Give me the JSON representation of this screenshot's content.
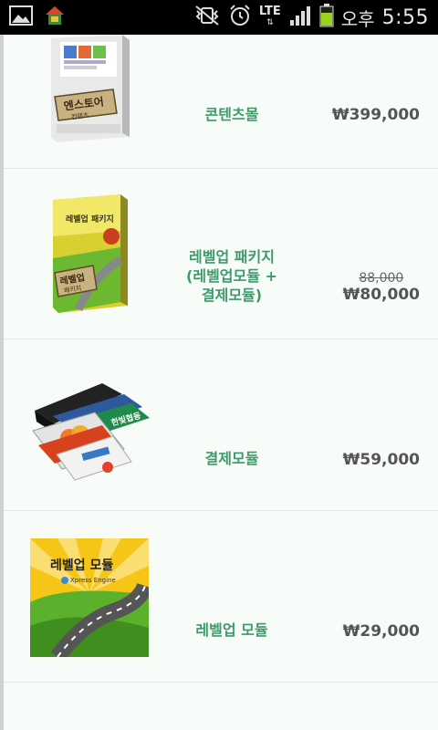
{
  "status_bar": {
    "ampm": "오후",
    "time": "5:55",
    "network": "LTE",
    "icons": [
      "gallery-icon",
      "home-app-icon",
      "vibrate-mute-icon",
      "alarm-icon",
      "lte-icon",
      "signal-icon",
      "battery-icon"
    ]
  },
  "colors": {
    "product_name": "#3f9a6a",
    "price": "#555555",
    "background": "#f7fcf9"
  },
  "products": [
    {
      "name": "콘텐츠몰",
      "price": "₩399,000",
      "old_price": ""
    },
    {
      "name": "레벨업 패키지 (레벨업모듈 + 결제모듈)",
      "price": "₩80,000",
      "old_price": "88,000"
    },
    {
      "name": "결제모듈",
      "price": "₩59,000",
      "old_price": ""
    },
    {
      "name": "레벨업 모듈",
      "price": "₩29,000",
      "old_price": ""
    }
  ],
  "thumb_text": {
    "box1": "엔스토어",
    "box1_sub": "컨텐츠",
    "box2_top": "레벨업 패키지",
    "box2_label": "레벨업",
    "box2_label_sub": "패키지",
    "module_title": "레벨업 모듈",
    "module_sub": "Xpress Engine",
    "card_text": "한빛협동"
  }
}
